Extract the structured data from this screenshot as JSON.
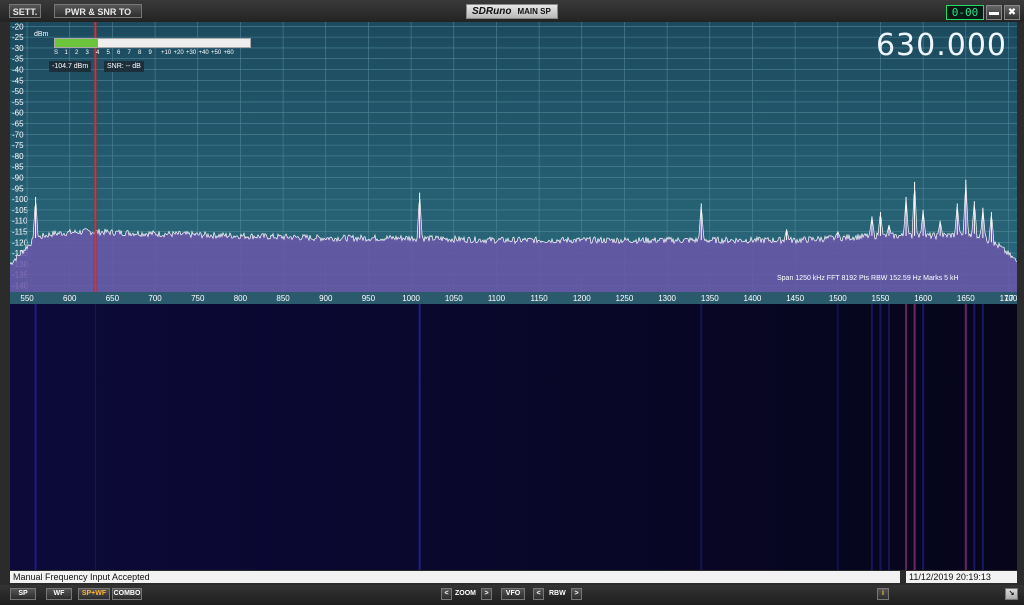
{
  "title_bar": {
    "sett_label": "SETT.",
    "csv_label": "PWR & SNR TO CSV",
    "logo": "SDRuno",
    "panel_name": "MAIN SP",
    "clock": "0-00",
    "minimize_icon": "minimize-icon",
    "close_icon": "close-icon"
  },
  "display": {
    "frequency": "630.000",
    "dbm_unit": "dBm",
    "power_readout": "-104.7 dBm",
    "snr_readout": "SNR: -- dB",
    "smeter_level_fraction": 0.22,
    "smeter_scale": [
      "S",
      "1",
      "2",
      "3",
      "4",
      "5",
      "6",
      "7",
      "8",
      "9",
      "+10",
      "+20",
      "+30",
      "+40",
      "+50",
      "+60"
    ],
    "spectrum_info": "Span 1250 kHz   FFT 8192 Pts   RBW 152.59 Hz   Marks 5 kH",
    "colors": {
      "spectrum_bg": "#1f4e61",
      "spectrum_fill": "#6a56a8",
      "trace": "#ffffff",
      "marker": "#c0262b",
      "waterfall_bg": "#06051a"
    }
  },
  "chart_data": {
    "type": "area",
    "title": "",
    "xlabel": "",
    "ylabel": "dBm",
    "x_unit": "kHz",
    "xlim": [
      530,
      1710
    ],
    "ylim": [
      -143,
      -18
    ],
    "y_ticks": [
      -20,
      -25,
      -30,
      -35,
      -40,
      -45,
      -50,
      -55,
      -60,
      -65,
      -70,
      -75,
      -80,
      -85,
      -90,
      -95,
      -100,
      -105,
      -110,
      -115,
      -120,
      -125,
      -130,
      -135,
      -140
    ],
    "x_ticks": [
      550,
      600,
      650,
      700,
      750,
      800,
      850,
      900,
      950,
      1000,
      1050,
      1100,
      1150,
      1200,
      1250,
      1300,
      1350,
      1400,
      1450,
      1500,
      1550,
      1600,
      1650,
      1700
    ],
    "x_tick_labels": [
      "550",
      "600",
      "650",
      "700",
      "750",
      "800",
      "850",
      "900",
      "950",
      "1000",
      "1050",
      "1100",
      "1150",
      "1200",
      "1250",
      "1300",
      "1350",
      "1400",
      "1450",
      "1500",
      "1550",
      "1600",
      "1650",
      "1700",
      "17"
    ],
    "grid": true,
    "marker_frequency": 630,
    "noise_floor": {
      "x": [
        530,
        545,
        560,
        580,
        620,
        700,
        800,
        900,
        1000,
        1100,
        1200,
        1300,
        1400,
        1450,
        1500,
        1540,
        1580,
        1620,
        1660,
        1690,
        1710
      ],
      "y": [
        -130,
        -124,
        -118,
        -116,
        -115,
        -116,
        -117,
        -118,
        -118,
        -119,
        -119,
        -119,
        -119,
        -119,
        -118,
        -117,
        -117,
        -117,
        -116,
        -122,
        -129
      ]
    },
    "peaks": [
      {
        "x": 560,
        "y": -99
      },
      {
        "x": 1010,
        "y": -97
      },
      {
        "x": 1340,
        "y": -102
      },
      {
        "x": 1440,
        "y": -114
      },
      {
        "x": 1500,
        "y": -115
      },
      {
        "x": 1540,
        "y": -108
      },
      {
        "x": 1550,
        "y": -106
      },
      {
        "x": 1560,
        "y": -112
      },
      {
        "x": 1580,
        "y": -99
      },
      {
        "x": 1590,
        "y": -92
      },
      {
        "x": 1600,
        "y": -105
      },
      {
        "x": 1620,
        "y": -110
      },
      {
        "x": 1640,
        "y": -102
      },
      {
        "x": 1650,
        "y": -91
      },
      {
        "x": 1660,
        "y": -101
      },
      {
        "x": 1670,
        "y": -104
      },
      {
        "x": 1680,
        "y": -106
      }
    ],
    "waterfall_lines": [
      {
        "x": 560,
        "intensity": 0.6
      },
      {
        "x": 1010,
        "intensity": 0.7
      },
      {
        "x": 1340,
        "intensity": 0.35
      },
      {
        "x": 1500,
        "intensity": 0.3
      },
      {
        "x": 1540,
        "intensity": 0.45
      },
      {
        "x": 1550,
        "intensity": 0.45
      },
      {
        "x": 1560,
        "intensity": 0.4
      },
      {
        "x": 1580,
        "intensity": 0.8
      },
      {
        "x": 1590,
        "intensity": 0.9
      },
      {
        "x": 1600,
        "intensity": 0.5
      },
      {
        "x": 1650,
        "intensity": 0.85
      },
      {
        "x": 1660,
        "intensity": 0.5
      },
      {
        "x": 1670,
        "intensity": 0.5
      }
    ]
  },
  "status": {
    "message": "Manual Frequency Input Accepted",
    "datetime": "11/12/2019 20:19:13"
  },
  "bottom_bar": {
    "sp": "SP",
    "wf": "WF",
    "spwf": "SP+WF",
    "combo": "COMBO",
    "zoom": "ZOOM",
    "vfo": "VFO",
    "rbw": "RBW",
    "left_arrow": "<",
    "right_arrow": ">",
    "info": "i",
    "resize_icon": "resize-icon"
  }
}
